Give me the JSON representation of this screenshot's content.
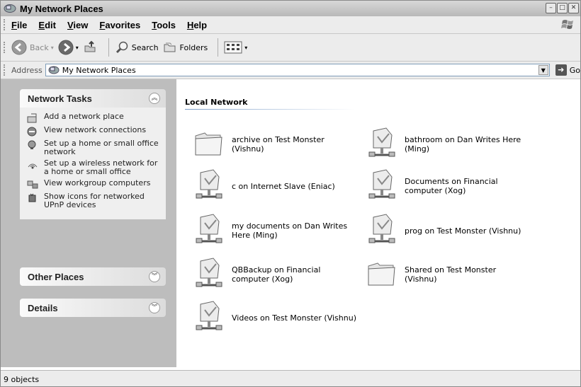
{
  "window": {
    "title": "My Network Places"
  },
  "menu": [
    "File",
    "Edit",
    "View",
    "Favorites",
    "Tools",
    "Help"
  ],
  "toolbar": {
    "back_label": "Back",
    "search_label": "Search",
    "folders_label": "Folders"
  },
  "address": {
    "label": "Address",
    "value": "My Network Places",
    "go_label": "Go"
  },
  "network_tasks": {
    "title": "Network Tasks",
    "items": [
      {
        "label": "Add a network place",
        "icon": "add-network-place-icon"
      },
      {
        "label": "View network connections",
        "icon": "network-connections-icon"
      },
      {
        "label": "Set up a home or small office network",
        "icon": "home-network-icon"
      },
      {
        "label": "Set up a wireless network for a home or small office",
        "icon": "wireless-network-icon"
      },
      {
        "label": "View workgroup computers",
        "icon": "workgroup-computers-icon"
      },
      {
        "label": "Show icons for networked UPnP devices",
        "icon": "upnp-devices-icon"
      }
    ]
  },
  "other_places": {
    "title": "Other Places"
  },
  "details": {
    "title": "Details"
  },
  "content": {
    "group_title": "Local Network",
    "items": [
      {
        "label": "archive on Test Monster (Vishnu)",
        "icon": "folder-icon"
      },
      {
        "label": "bathroom on Dan Writes Here (Ming)",
        "icon": "network-share-icon"
      },
      {
        "label": "c on Internet Slave (Eniac)",
        "icon": "network-share-icon"
      },
      {
        "label": "Documents on Financial computer (Xog)",
        "icon": "network-share-icon"
      },
      {
        "label": "my documents on Dan Writes Here (Ming)",
        "icon": "network-share-icon"
      },
      {
        "label": "prog on Test Monster (Vishnu)",
        "icon": "network-share-icon"
      },
      {
        "label": "QBBackup on Financial computer (Xog)",
        "icon": "network-share-icon"
      },
      {
        "label": "Shared on Test Monster (Vishnu)",
        "icon": "folder-icon"
      },
      {
        "label": "Videos on Test Monster (Vishnu)",
        "icon": "network-share-icon"
      }
    ]
  },
  "status": {
    "text": "9 objects"
  }
}
